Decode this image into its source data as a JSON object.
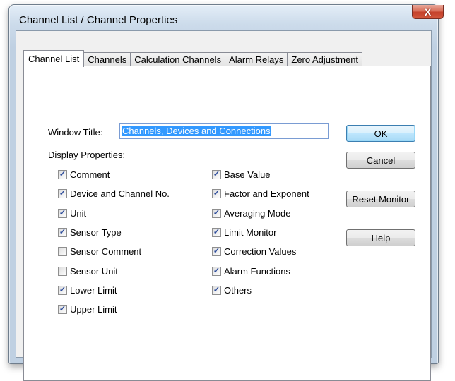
{
  "window": {
    "title": "Channel List / Channel Properties",
    "close_glyph": "X"
  },
  "tabs": [
    {
      "label": "Channel List",
      "active": true
    },
    {
      "label": "Channels",
      "active": false
    },
    {
      "label": "Calculation Channels",
      "active": false
    },
    {
      "label": "Alarm Relays",
      "active": false
    },
    {
      "label": "Zero Adjustment",
      "active": false
    }
  ],
  "form": {
    "window_title_label": "Window Title:",
    "window_title_value": "Channels, Devices and Connections",
    "display_properties_label": "Display Properties:"
  },
  "checkboxes": {
    "left": [
      {
        "label": "Comment",
        "checked": true
      },
      {
        "label": "Device and Channel No.",
        "checked": true
      },
      {
        "label": "Unit",
        "checked": true
      },
      {
        "label": "Sensor Type",
        "checked": true
      },
      {
        "label": "Sensor Comment",
        "checked": false
      },
      {
        "label": "Sensor Unit",
        "checked": false
      },
      {
        "label": "Lower Limit",
        "checked": true
      },
      {
        "label": "Upper Limit",
        "checked": true
      }
    ],
    "right": [
      {
        "label": "Base Value",
        "checked": true
      },
      {
        "label": "Factor and Exponent",
        "checked": true
      },
      {
        "label": "Averaging Mode",
        "checked": true
      },
      {
        "label": "Limit Monitor",
        "checked": true
      },
      {
        "label": "Correction Values",
        "checked": true
      },
      {
        "label": "Alarm Functions",
        "checked": true
      },
      {
        "label": "Others",
        "checked": true
      }
    ]
  },
  "buttons": {
    "ok": "OK",
    "cancel": "Cancel",
    "reset_monitor": "Reset Monitor",
    "help": "Help"
  },
  "colors": {
    "accent": "#3399ff",
    "close": "#c4402a",
    "check": "#2a4a9a"
  }
}
